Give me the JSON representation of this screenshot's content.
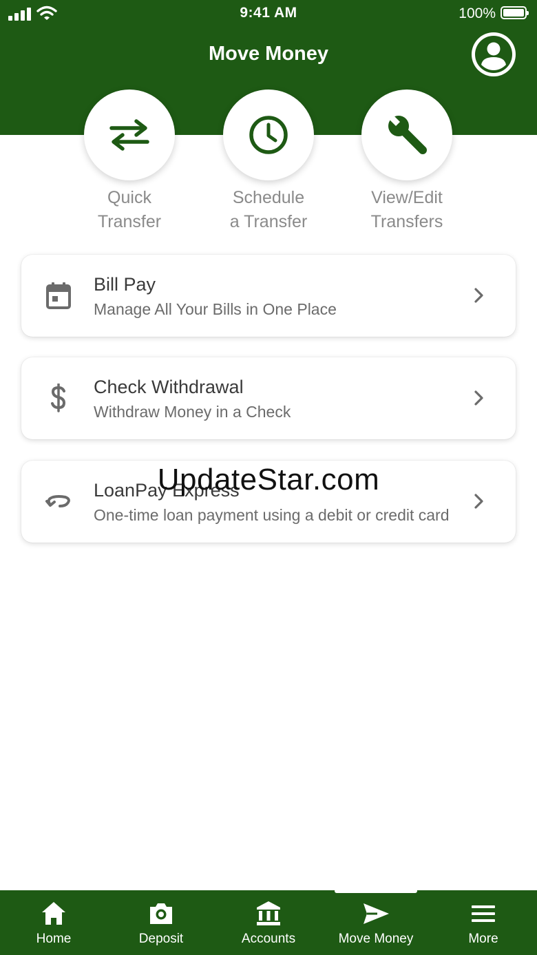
{
  "status_bar": {
    "time": "9:41 AM",
    "battery_percent": "100%",
    "signal_icon": "cellular-signal-icon",
    "wifi_icon": "wifi-icon",
    "battery_icon": "battery-full-icon"
  },
  "header": {
    "title": "Move Money",
    "profile_icon": "user-profile-icon"
  },
  "colors": {
    "brand_green": "#1e5a14",
    "icon_green": "#1e5a14",
    "label_gray": "#8a8a8a"
  },
  "quick_actions": [
    {
      "line1": "Quick",
      "line2": "Transfer",
      "icon": "transfer-arrows-icon"
    },
    {
      "line1": "Schedule",
      "line2": "a Transfer",
      "icon": "clock-icon"
    },
    {
      "line1": "View/Edit",
      "line2": "Transfers",
      "icon": "wrench-icon"
    }
  ],
  "menu_cards": [
    {
      "title": "Bill Pay",
      "subtitle": "Manage All Your Bills in One Place",
      "icon": "calendar-icon"
    },
    {
      "title": "Check Withdrawal",
      "subtitle": "Withdraw Money in a Check",
      "icon": "dollar-icon"
    },
    {
      "title": "LoanPay Express",
      "subtitle": "One-time loan payment using a debit or credit card",
      "icon": "loop-arrow-icon"
    }
  ],
  "watermark": "UpdateStar.com",
  "tab_bar": {
    "active": "Move Money",
    "tabs": [
      {
        "label": "Home",
        "icon": "home-icon"
      },
      {
        "label": "Deposit",
        "icon": "camera-icon"
      },
      {
        "label": "Accounts",
        "icon": "bank-icon"
      },
      {
        "label": "Move Money",
        "icon": "send-icon"
      },
      {
        "label": "More",
        "icon": "menu-icon"
      }
    ]
  }
}
